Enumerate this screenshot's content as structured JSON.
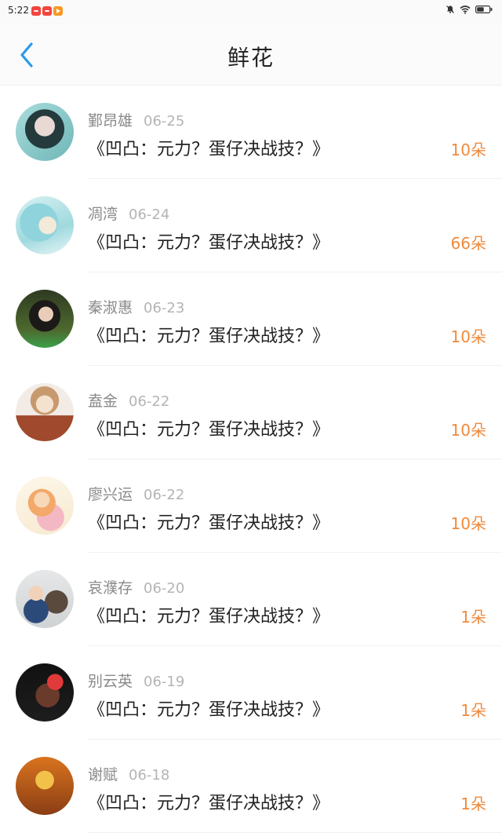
{
  "status_bar": {
    "time": "5:22"
  },
  "header": {
    "title": "鲜花"
  },
  "colors": {
    "accent_blue": "#2b9ae8",
    "amount_orange": "#ef8a3c"
  },
  "items": [
    {
      "name": "鄞昂雄",
      "date": "06-25",
      "book": "《凹凸：元力？蛋仔决战技？》",
      "amount": "10朵"
    },
    {
      "name": "凋湾",
      "date": "06-24",
      "book": "《凹凸：元力？蛋仔决战技？》",
      "amount": "66朵"
    },
    {
      "name": "秦淑惠",
      "date": "06-23",
      "book": "《凹凸：元力？蛋仔决战技？》",
      "amount": "10朵"
    },
    {
      "name": "盍金",
      "date": "06-22",
      "book": "《凹凸：元力？蛋仔决战技？》",
      "amount": "10朵"
    },
    {
      "name": "廖兴运",
      "date": "06-22",
      "book": "《凹凸：元力？蛋仔决战技？》",
      "amount": "10朵"
    },
    {
      "name": "哀濮存",
      "date": "06-20",
      "book": "《凹凸：元力？蛋仔决战技？》",
      "amount": "1朵"
    },
    {
      "name": "别云英",
      "date": "06-19",
      "book": "《凹凸：元力？蛋仔决战技？》",
      "amount": "1朵"
    },
    {
      "name": "谢赋",
      "date": "06-18",
      "book": "《凹凸：元力？蛋仔决战技？》",
      "amount": "1朵"
    }
  ]
}
